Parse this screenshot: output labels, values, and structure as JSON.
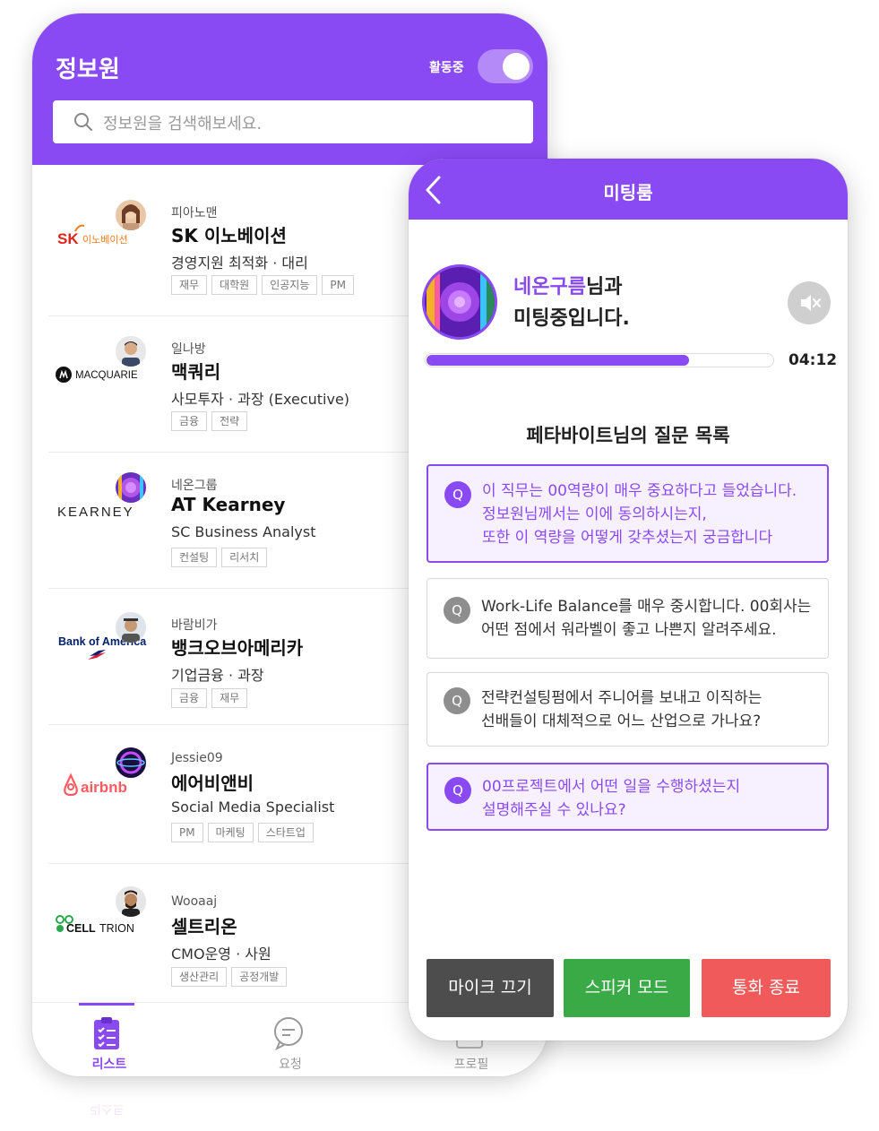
{
  "list_screen": {
    "title": "정보원",
    "status_label": "활동중",
    "toggle_on": true,
    "search": {
      "placeholder": "정보원을 검색해보세요."
    },
    "items": [
      {
        "nick": "피아노맨",
        "company": "SK 이노베이션",
        "role": "경영지원 최적화 · 대리",
        "tags": [
          "재무",
          "대학원",
          "인공지능",
          "PM"
        ],
        "logo": "SK 이노베이션"
      },
      {
        "nick": "일나방",
        "company": "맥쿼리",
        "role": "사모투자 · 과장 (Executive)",
        "tags": [
          "금융",
          "전략"
        ],
        "logo": "MACQUARIE"
      },
      {
        "nick": "네온그룹",
        "company": "AT Kearney",
        "role": "SC Business Analyst",
        "tags": [
          "컨설팅",
          "리서치"
        ],
        "logo": "KEARNEY"
      },
      {
        "nick": "바람비가",
        "company": "뱅크오브아메리카",
        "role": "기업금융 · 과장",
        "tags": [
          "금융",
          "재무"
        ],
        "logo": "Bank of America"
      },
      {
        "nick": "Jessie09",
        "company": "에어비앤비",
        "role": "Social Media Specialist",
        "tags": [
          "PM",
          "마케팅",
          "스타트업"
        ],
        "logo": "airbnb"
      },
      {
        "nick": "Wooaaj",
        "company": "셀트리온",
        "role": "CMO운영 · 사원",
        "tags": [
          "생산관리",
          "공정개발"
        ],
        "logo": "CELLTRION"
      }
    ],
    "nav": [
      {
        "label": "리스트",
        "icon": "clipboard-list-icon",
        "active": true
      },
      {
        "label": "요청",
        "icon": "chat-bubble-icon",
        "active": false
      },
      {
        "label": "프로필",
        "icon": "profile-icon",
        "active": false
      }
    ]
  },
  "meeting_screen": {
    "title": "미팅룸",
    "partner_name": "네온구름",
    "message_suffix": "님과",
    "message_line2": "미팅중입니다.",
    "progress": 0.76,
    "timer": "04:12",
    "questions_title": "페타바이트님의 질문 목록",
    "question_badge": "Q",
    "questions": [
      {
        "lines": [
          "이 직무는 00역량이 매우 중요하다고 들었습니다.",
          "정보원님께서는 이에 동의하시는지,",
          "또한 이 역량을 어떻게 갖추셨는지 궁금합니다"
        ],
        "active": true
      },
      {
        "lines": [
          "Work-Life Balance를 매우 중시합니다. 00회사는",
          "어떤 점에서 워라벨이 좋고 나쁜지 알려주세요."
        ],
        "active": false
      },
      {
        "lines": [
          "전략컨설팅펌에서 주니어를 보내고 이직하는",
          "선배들이 대체적으로 어느 산업으로 가나요?"
        ],
        "active": false
      },
      {
        "lines": [
          "00프로젝트에서 어떤 일을 수행하셨는지",
          "설명해주실 수 있나요?"
        ],
        "active": true
      }
    ],
    "buttons": {
      "mic_off": "마이크 끄기",
      "speaker_mode": "스피커 모드",
      "end_call": "통화 종료"
    },
    "colors": {
      "accent": "#8a4af3",
      "mic": "#4d4d4d",
      "speaker": "#3aaa46",
      "end": "#f05a5a"
    }
  }
}
